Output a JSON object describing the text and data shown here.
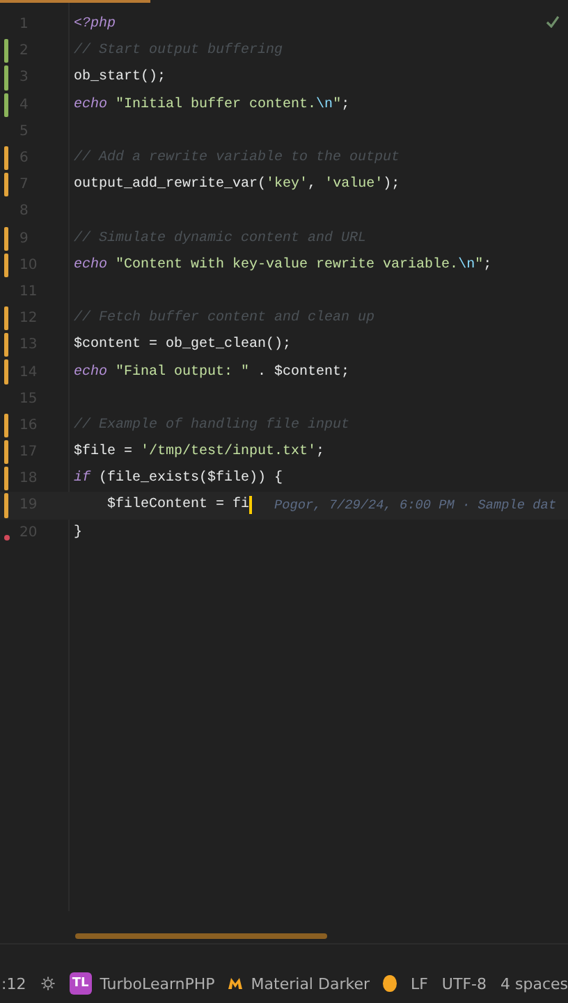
{
  "editor": {
    "lines": [
      {
        "number": "1",
        "added": false,
        "modified": false,
        "deleted": false,
        "current": false,
        "tokens": [
          {
            "kind": "keyword",
            "text": "<?php"
          }
        ]
      },
      {
        "number": "2",
        "added": true,
        "modified": false,
        "deleted": false,
        "current": false,
        "tokens": [
          {
            "kind": "comment",
            "text": "// Start output buffering"
          }
        ]
      },
      {
        "number": "3",
        "added": true,
        "modified": false,
        "deleted": false,
        "current": false,
        "tokens": [
          {
            "kind": "plain",
            "text": "ob_start();"
          }
        ]
      },
      {
        "number": "4",
        "added": true,
        "modified": false,
        "deleted": false,
        "current": false,
        "tokens": [
          {
            "kind": "keyword",
            "text": "echo "
          },
          {
            "kind": "string",
            "text": "\"Initial buffer content."
          },
          {
            "kind": "escape",
            "text": "\\n"
          },
          {
            "kind": "string",
            "text": "\""
          },
          {
            "kind": "plain",
            "text": ";"
          }
        ]
      },
      {
        "number": "5",
        "added": false,
        "modified": false,
        "deleted": false,
        "current": false
      },
      {
        "number": "6",
        "added": false,
        "modified": true,
        "deleted": false,
        "current": false,
        "tokens": [
          {
            "kind": "comment",
            "text": "// Add a rewrite variable to the output"
          }
        ]
      },
      {
        "number": "7",
        "added": false,
        "modified": true,
        "deleted": false,
        "current": false,
        "tokens": [
          {
            "kind": "plain",
            "text": "output_add_rewrite_var("
          },
          {
            "kind": "string",
            "text": "'key'"
          },
          {
            "kind": "plain",
            "text": ", "
          },
          {
            "kind": "string",
            "text": "'value'"
          },
          {
            "kind": "plain",
            "text": ");"
          }
        ]
      },
      {
        "number": "8",
        "added": false,
        "modified": false,
        "deleted": false,
        "current": false
      },
      {
        "number": "9",
        "added": false,
        "modified": true,
        "deleted": false,
        "current": false,
        "tokens": [
          {
            "kind": "comment",
            "text": "// Simulate dynamic content and URL"
          }
        ]
      },
      {
        "number": "10",
        "added": false,
        "modified": true,
        "deleted": false,
        "current": false,
        "tokens": [
          {
            "kind": "keyword",
            "text": "echo "
          },
          {
            "kind": "string",
            "text": "\"Content with key-value rewrite variable."
          },
          {
            "kind": "escape",
            "text": "\\n"
          },
          {
            "kind": "string",
            "text": "\""
          },
          {
            "kind": "plain",
            "text": ";"
          }
        ]
      },
      {
        "number": "11",
        "added": false,
        "modified": false,
        "deleted": false,
        "current": false
      },
      {
        "number": "12",
        "added": false,
        "modified": true,
        "deleted": false,
        "current": false,
        "tokens": [
          {
            "kind": "comment",
            "text": "// Fetch buffer content and clean up"
          }
        ]
      },
      {
        "number": "13",
        "added": false,
        "modified": true,
        "deleted": false,
        "current": false,
        "tokens": [
          {
            "kind": "plain",
            "text": "$content = ob_get_clean();"
          }
        ]
      },
      {
        "number": "14",
        "added": false,
        "modified": true,
        "deleted": false,
        "current": false,
        "tokens": [
          {
            "kind": "keyword",
            "text": "echo "
          },
          {
            "kind": "string",
            "text": "\"Final output: \""
          },
          {
            "kind": "plain",
            "text": " . $content;"
          }
        ]
      },
      {
        "number": "15",
        "added": false,
        "modified": false,
        "deleted": false,
        "current": false
      },
      {
        "number": "16",
        "added": false,
        "modified": true,
        "deleted": false,
        "current": false,
        "tokens": [
          {
            "kind": "comment",
            "text": "// Example of handling file input"
          }
        ]
      },
      {
        "number": "17",
        "added": false,
        "modified": true,
        "deleted": false,
        "current": false,
        "tokens": [
          {
            "kind": "plain",
            "text": "$file = "
          },
          {
            "kind": "string",
            "text": "'/tmp/test/input.txt'"
          },
          {
            "kind": "plain",
            "text": ";"
          }
        ]
      },
      {
        "number": "18",
        "added": false,
        "modified": true,
        "deleted": false,
        "current": false,
        "tokens": [
          {
            "kind": "keyword",
            "text": "if "
          },
          {
            "kind": "plain",
            "text": "(file_exists($file)) {"
          }
        ]
      },
      {
        "number": "19",
        "added": false,
        "modified": true,
        "deleted": false,
        "current": true,
        "tokens": [
          {
            "kind": "plain",
            "text": "    $fileContent = fi"
          }
        ],
        "blame": "Pogor, 7/29/24, 6:00 PM · Sample dat"
      },
      {
        "number": "20",
        "added": false,
        "modified": false,
        "deleted": true,
        "current": false,
        "tokens": [
          {
            "kind": "plain",
            "text": "}"
          }
        ]
      }
    ]
  },
  "status_bar": {
    "position": ":12",
    "project": {
      "badge": "TL",
      "name": "TurboLearnPHP"
    },
    "theme": "Material Darker",
    "line_separator": "LF",
    "encoding": "UTF-8",
    "indent": "4 spaces"
  }
}
